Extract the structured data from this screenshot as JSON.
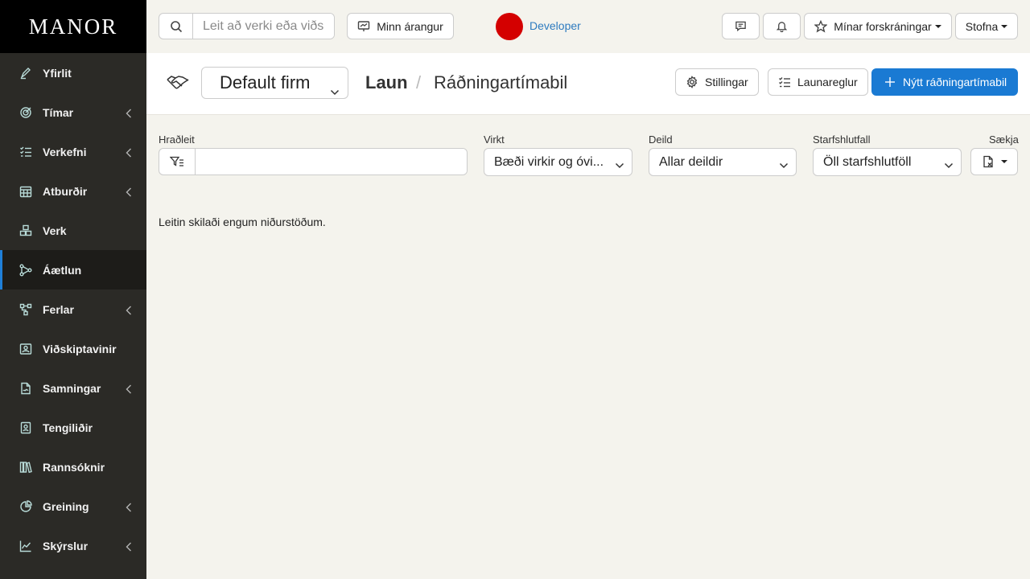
{
  "sidebar": {
    "logo": "MANOR",
    "items": [
      {
        "label": "Yfirlit",
        "icon": "pen-icon",
        "chevron": false,
        "active": false
      },
      {
        "label": "Tímar",
        "icon": "target-icon",
        "chevron": true,
        "active": false
      },
      {
        "label": "Verkefni",
        "icon": "checklist-icon",
        "chevron": true,
        "active": false
      },
      {
        "label": "Atburðir",
        "icon": "calendar-icon",
        "chevron": true,
        "active": false
      },
      {
        "label": "Verk",
        "icon": "cubes-icon",
        "chevron": false,
        "active": false
      },
      {
        "label": "Áætlun",
        "icon": "flow-icon",
        "chevron": false,
        "active": true
      },
      {
        "label": "Ferlar",
        "icon": "process-icon",
        "chevron": true,
        "active": false
      },
      {
        "label": "Viðskiptavinir",
        "icon": "clients-icon",
        "chevron": false,
        "active": false
      },
      {
        "label": "Samningar",
        "icon": "contract-icon",
        "chevron": true,
        "active": false
      },
      {
        "label": "Tengiliðir",
        "icon": "contact-icon",
        "chevron": false,
        "active": false
      },
      {
        "label": "Rannsóknir",
        "icon": "books-icon",
        "chevron": false,
        "active": false
      },
      {
        "label": "Greining",
        "icon": "pie-icon",
        "chevron": true,
        "active": false
      },
      {
        "label": "Skýrslur",
        "icon": "line-chart-icon",
        "chevron": true,
        "active": false
      }
    ]
  },
  "topbar": {
    "search_placeholder": "Leit að verki eða viðskiptavini",
    "performance_label": "Minn árangur",
    "user_name": "Developer",
    "favorites_label": "Mínar forskráningar",
    "create_label": "Stofna"
  },
  "header": {
    "firm": "Default firm",
    "crumb_main": "Laun",
    "crumb_sep": "/",
    "crumb_sub": "Ráðningartímabil",
    "settings_label": "Stillingar",
    "rules_label": "Launareglur",
    "new_label": "Nýtt ráðningartímabil"
  },
  "filters": {
    "quicksearch_label": "Hraðleit",
    "active_label": "Virkt",
    "active_value": "Bæði virkir og óvi...",
    "department_label": "Deild",
    "department_value": "Allar deildir",
    "ratio_label": "Starfshlutfall",
    "ratio_value": "Öll starfshlutföll",
    "export_label": "Sækja"
  },
  "results": {
    "empty_message": "Leitin skilaði engum niðurstöðum."
  },
  "colors": {
    "primary": "#1a7ad3",
    "sidebar_bg": "#2b2a26",
    "active_indicator": "#1f7fd8",
    "user_dot": "#d40000"
  }
}
